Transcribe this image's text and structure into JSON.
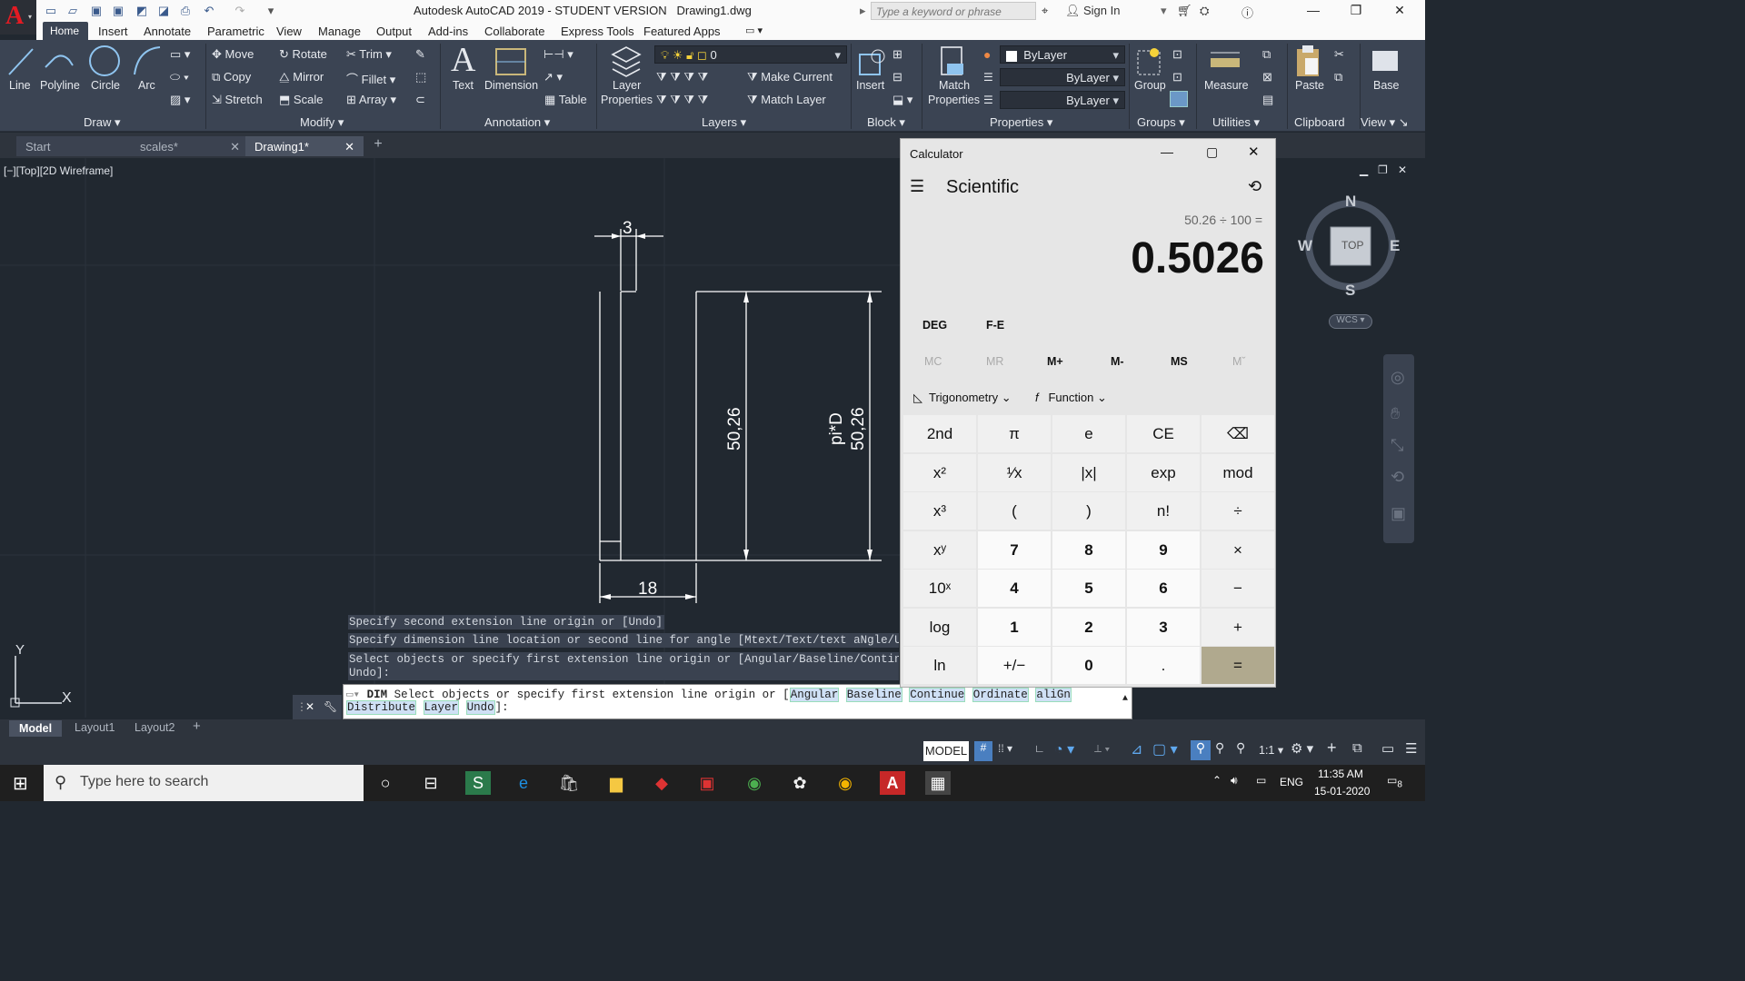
{
  "window": {
    "title": "Autodesk AutoCAD 2019 - STUDENT VERSION",
    "drawing": "Drawing1.dwg",
    "search_placeholder": "Type a keyword or phrase",
    "sign_in": "Sign In"
  },
  "menu_tabs": [
    "Home",
    "Insert",
    "Annotate",
    "Parametric",
    "View",
    "Manage",
    "Output",
    "Add-ins",
    "Collaborate",
    "Express Tools",
    "Featured Apps"
  ],
  "ribbon": {
    "draw": {
      "line": "Line",
      "polyline": "Polyline",
      "circle": "Circle",
      "arc": "Arc",
      "panel": "Draw"
    },
    "modify": {
      "move": "Move",
      "rotate": "Rotate",
      "trim": "Trim",
      "copy": "Copy",
      "mirror": "Mirror",
      "fillet": "Fillet",
      "stretch": "Stretch",
      "scale": "Scale",
      "array": "Array",
      "panel": "Modify"
    },
    "annotation": {
      "text": "Text",
      "dimension": "Dimension",
      "table": "Table",
      "panel": "Annotation"
    },
    "layers": {
      "layer_properties_1": "Layer",
      "layer_properties_2": "Properties",
      "current_layer": "0",
      "make_current": "Make Current",
      "match_layer": "Match Layer",
      "panel": "Layers"
    },
    "block": {
      "insert": "Insert",
      "panel": "Block"
    },
    "properties": {
      "match_1": "Match",
      "match_2": "Properties",
      "color": "ByLayer",
      "linetype": "ByLayer",
      "lineweight": "ByLayer",
      "panel": "Properties"
    },
    "groups": {
      "group": "Group",
      "panel": "Groups"
    },
    "utilities": {
      "measure": "Measure",
      "panel": "Utilities"
    },
    "clipboard": {
      "paste": "Paste",
      "panel": "Clipboard"
    },
    "view": {
      "base": "Base",
      "panel": "View"
    }
  },
  "doc_tabs": [
    "Start",
    "scales*",
    "Drawing1*"
  ],
  "viewport_label": "[−][Top][2D Wireframe]",
  "drawing": {
    "dim_width_small": "3",
    "dim_height_1": "50,26",
    "dim_height_2_line1": "pi*D",
    "dim_height_2_line2": "50,26",
    "dim_width_bottom": "18"
  },
  "viewcube": {
    "north": "N",
    "south": "S",
    "east": "E",
    "west": "W",
    "top": "TOP",
    "wcs": "WCS"
  },
  "ucs": {
    "x": "X",
    "y": "Y"
  },
  "command_history": [
    "Specify second extension line origin or [Undo]:",
    "Specify dimension line location or second line for angle [Mtext/Text/text aNgle/Und",
    "Select objects or specify first extension line origin or [Angular/Baseline/Continue",
    "Undo]:"
  ],
  "command": {
    "name": "DIM",
    "prompt": "Select objects or specify first extension line origin or [",
    "kw": [
      "Angular",
      "Baseline",
      "Continue",
      "Ordinate",
      "aliGn",
      "Distribute",
      "Layer",
      "Undo"
    ],
    "end": "]:"
  },
  "layout_tabs": [
    "Model",
    "Layout1",
    "Layout2"
  ],
  "status": {
    "model": "MODEL",
    "scale": "1:1"
  },
  "taskbar": {
    "search": "Type here to search",
    "lang": "ENG",
    "time": "11:35 AM",
    "date": "15-01-2020",
    "notif": "8"
  },
  "calculator": {
    "title": "Calculator",
    "mode": "Scientific",
    "expression": "50.26 ÷ 100 =",
    "display": "0.5026",
    "deg": "DEG",
    "fe": "F-E",
    "memory": [
      "MC",
      "MR",
      "M+",
      "M-",
      "MS",
      "Mˇ"
    ],
    "trig": "Trigonometry",
    "func": "Function",
    "keys": [
      [
        "2nd",
        "π",
        "e",
        "CE",
        "⌫"
      ],
      [
        "x²",
        "¹⁄x",
        "|x|",
        "exp",
        "mod"
      ],
      [
        "x³",
        "(",
        ")",
        "n!",
        "÷"
      ],
      [
        "xʸ",
        "7",
        "8",
        "9",
        "×"
      ],
      [
        "10ˣ",
        "4",
        "5",
        "6",
        "−"
      ],
      [
        "log",
        "1",
        "2",
        "3",
        "+"
      ],
      [
        "ln",
        "+/−",
        "0",
        ".",
        "="
      ]
    ]
  }
}
